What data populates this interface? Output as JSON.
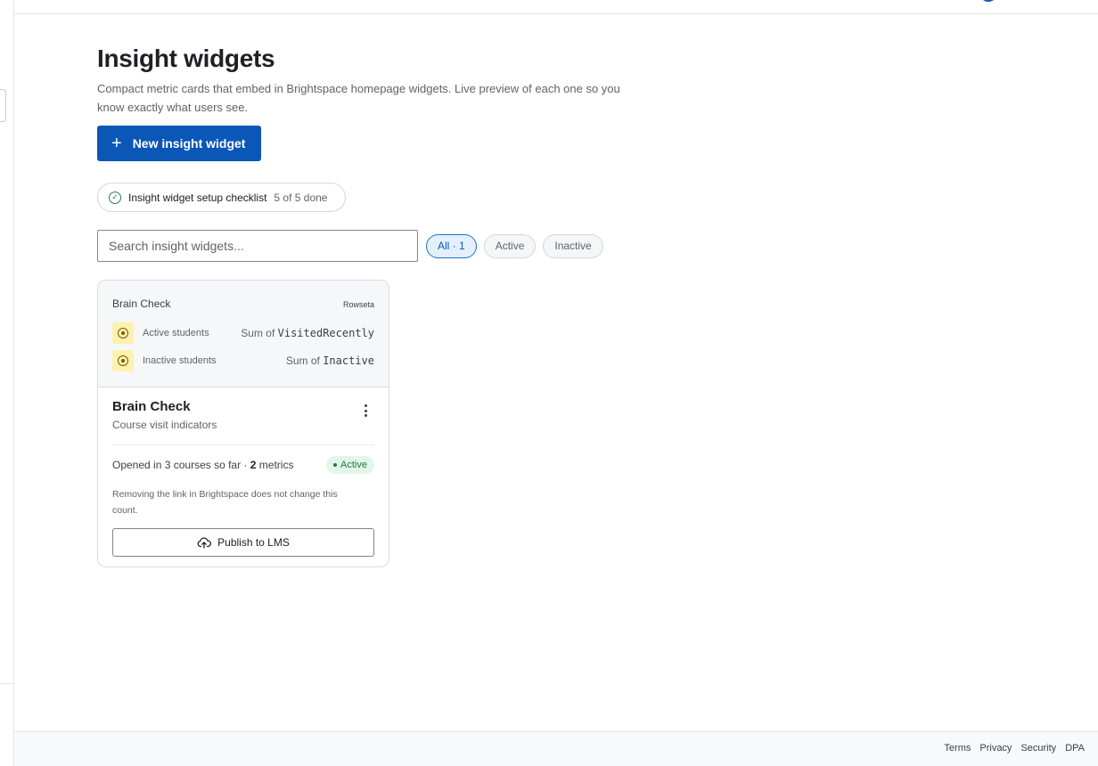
{
  "page": {
    "title": "Insight widgets",
    "subtitle": "Compact metric cards that embed in Brightspace homepage widgets. Live preview of each one so you know exactly what users see."
  },
  "actions": {
    "new_widget_label": "New insight widget"
  },
  "checklist": {
    "label": "Insight widget setup checklist",
    "count": "5 of 5 done"
  },
  "search": {
    "placeholder": "Search insight widgets..."
  },
  "filters": [
    {
      "label": "All · 1",
      "selected": true
    },
    {
      "label": "Active",
      "selected": false
    },
    {
      "label": "Inactive",
      "selected": false
    }
  ],
  "card": {
    "preview": {
      "title": "Brain Check",
      "brand": "Rowseta",
      "metrics": [
        {
          "label": "Active students",
          "agg": "Sum of",
          "field": "VisitedRecently"
        },
        {
          "label": "Inactive students",
          "agg": "Sum of",
          "field": "Inactive"
        }
      ]
    },
    "title": "Brain Check",
    "subtitle": "Course visit indicators",
    "stats_prefix": "Opened in 3 courses so far ·",
    "metric_count": "2",
    "metric_suffix": "metrics",
    "status": "Active",
    "note": "Removing the link in Brightspace does not change this count.",
    "publish_label": "Publish to LMS"
  },
  "footer": {
    "links": [
      "Terms",
      "Privacy",
      "Security",
      "DPA"
    ]
  },
  "colors": {
    "primary": "#0b57b8",
    "active_badge_bg": "#e3f6e8",
    "active_badge_text": "#1e7a3c",
    "metric_icon_bg": "#fdf1b0"
  }
}
